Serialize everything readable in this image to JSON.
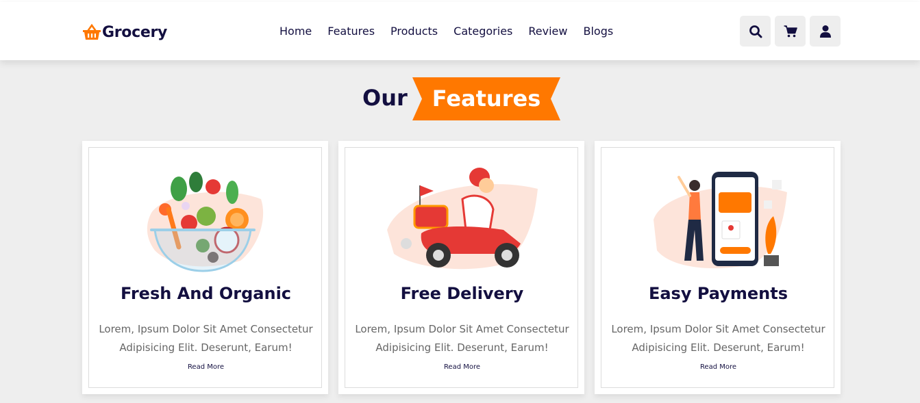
{
  "brand": {
    "name": "Grocery",
    "icon": "shopping-basket-icon",
    "color": "#ff7800"
  },
  "nav": [
    {
      "label": "Home"
    },
    {
      "label": "Features"
    },
    {
      "label": "Products"
    },
    {
      "label": "Categories"
    },
    {
      "label": "Review"
    },
    {
      "label": "Blogs"
    }
  ],
  "header_icons": [
    "search-icon",
    "cart-icon",
    "user-icon"
  ],
  "section": {
    "heading_prefix": "Our",
    "heading_highlight": "Features",
    "accent": "#ff7800",
    "text_color": "#130f40"
  },
  "features": [
    {
      "title": "Fresh And Organic",
      "text": "Lorem, Ipsum Dolor Sit Amet Consectetur Adipisicing Elit. Deserunt, Earum!",
      "link": "Read More",
      "image": "salad-bowl-illustration"
    },
    {
      "title": "Free Delivery",
      "text": "Lorem, Ipsum Dolor Sit Amet Consectetur Adipisicing Elit. Deserunt, Earum!",
      "link": "Read More",
      "image": "scooter-delivery-illustration"
    },
    {
      "title": "Easy Payments",
      "text": "Lorem, Ipsum Dolor Sit Amet Consectetur Adipisicing Elit. Deserunt, Earum!",
      "link": "Read More",
      "image": "mobile-payment-illustration"
    }
  ]
}
